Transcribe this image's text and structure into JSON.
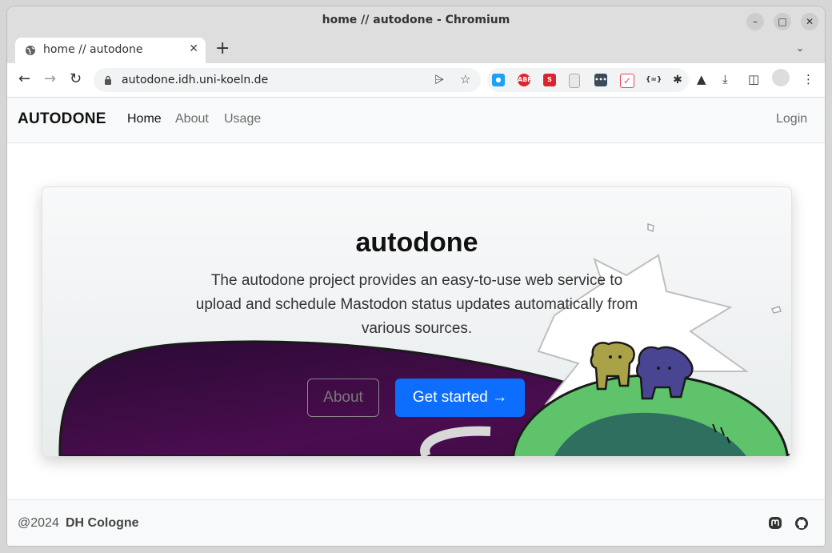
{
  "browser": {
    "window_title": "home // autodone - Chromium",
    "tab_title": "home // autodone",
    "url": "autodone.idh.uni-koeln.de"
  },
  "site": {
    "brand": "AUTODONE",
    "nav": [
      {
        "label": "Home",
        "active": true
      },
      {
        "label": "About",
        "active": false
      },
      {
        "label": "Usage",
        "active": false
      }
    ],
    "login_label": "Login"
  },
  "hero": {
    "title": "autodone",
    "description": "The autodone project provides an easy-to-use web service to upload and schedule Mastodon status updates automatically from various sources.",
    "about_button": "About",
    "start_button": "Get started →"
  },
  "footer": {
    "copyright": "@2024",
    "org": "DH Cologne",
    "icons": [
      "mastodon-icon",
      "github-icon"
    ]
  },
  "colors": {
    "primary": "#0d6efd",
    "planet_green": "#5ec36a",
    "space_purple": "#3b0a3f"
  }
}
